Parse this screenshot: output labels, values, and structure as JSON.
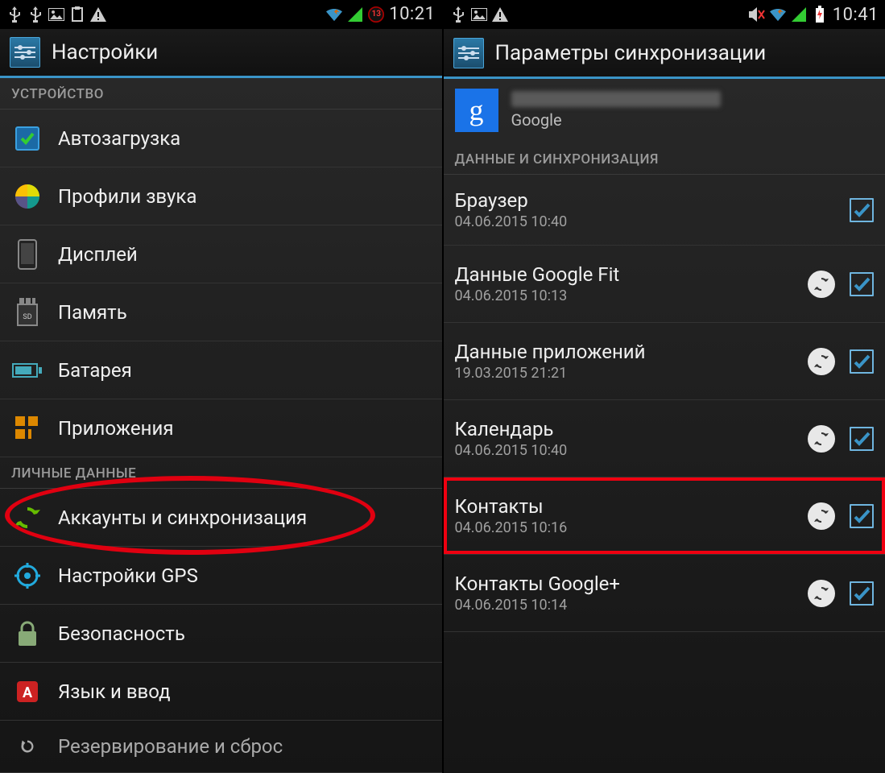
{
  "left": {
    "status": {
      "time": "10:21",
      "badge_count": "13",
      "icons": [
        "usb",
        "usb",
        "image",
        "clipboard",
        "warning"
      ],
      "right_icons": [
        "wifi",
        "signal",
        "battery-alert"
      ]
    },
    "action_title": "Настройки",
    "sections": [
      {
        "header": "УСТРОЙСТВО",
        "items": [
          {
            "icon": "autoboot",
            "label": "Автозагрузка"
          },
          {
            "icon": "sound",
            "label": "Профили звука"
          },
          {
            "icon": "display",
            "label": "Дисплей"
          },
          {
            "icon": "storage",
            "label": "Память"
          },
          {
            "icon": "battery",
            "label": "Батарея"
          },
          {
            "icon": "apps",
            "label": "Приложения"
          }
        ]
      },
      {
        "header": "ЛИЧНЫЕ ДАННЫЕ",
        "items": [
          {
            "icon": "sync",
            "label": "Аккаунты и синхронизация",
            "highlight": true
          },
          {
            "icon": "gps",
            "label": "Настройки GPS"
          },
          {
            "icon": "security",
            "label": "Безопасность"
          },
          {
            "icon": "language",
            "label": "Язык и ввод"
          },
          {
            "icon": "reset",
            "label": "Резервирование и сброс"
          }
        ]
      }
    ]
  },
  "right": {
    "status": {
      "time": "10:41",
      "icons": [
        "usb",
        "image",
        "warning"
      ],
      "right_icons": [
        "mute",
        "wifi",
        "signal",
        "battery-charging"
      ]
    },
    "action_title": "Параметры синхронизации",
    "account": {
      "provider": "Google"
    },
    "section_header": "ДАННЫЕ И СИНХРОНИЗАЦИЯ",
    "items": [
      {
        "label": "Браузер",
        "sub": "04.06.2015 10:40",
        "sync": false,
        "checked": true
      },
      {
        "label": "Данные Google Fit",
        "sub": "04.06.2015 10:13",
        "sync": true,
        "checked": true
      },
      {
        "label": "Данные приложений",
        "sub": "19.03.2015 21:21",
        "sync": true,
        "checked": true
      },
      {
        "label": "Календарь",
        "sub": "04.06.2015 10:40",
        "sync": true,
        "checked": true
      },
      {
        "label": "Контакты",
        "sub": "04.06.2015 10:16",
        "sync": true,
        "checked": true,
        "highlight": true
      },
      {
        "label": "Контакты Google+",
        "sub": "04.06.2015 10:14",
        "sync": true,
        "checked": true
      }
    ]
  }
}
